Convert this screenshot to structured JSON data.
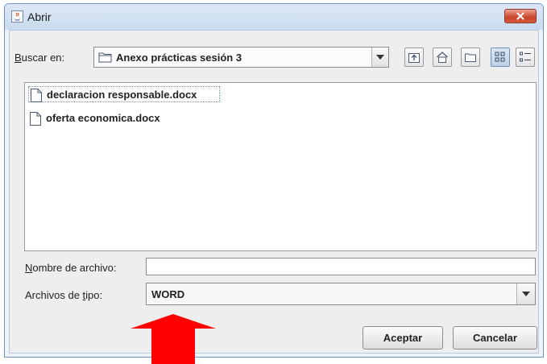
{
  "window": {
    "title": "Abrir"
  },
  "look_in": {
    "label_u": "B",
    "label_rest": "uscar en:",
    "value": "Anexo prácticas sesión 3"
  },
  "toolbar": [
    "up-one-level",
    "home",
    "new-folder",
    "list-view",
    "details-view"
  ],
  "files": [
    {
      "name": "declaracion responsable.docx",
      "selected": true
    },
    {
      "name": "oferta economica.docx",
      "selected": false
    }
  ],
  "filename": {
    "label_u": "N",
    "label_rest": "ombre de archivo:",
    "value": ""
  },
  "filetype": {
    "label_pre": "Archivos de ",
    "label_u": "t",
    "label_rest": "ipo:",
    "value": "WORD"
  },
  "buttons": {
    "accept": "Aceptar",
    "cancel": "Cancelar"
  },
  "annotation": {
    "arrow_color": "#ff0000"
  }
}
